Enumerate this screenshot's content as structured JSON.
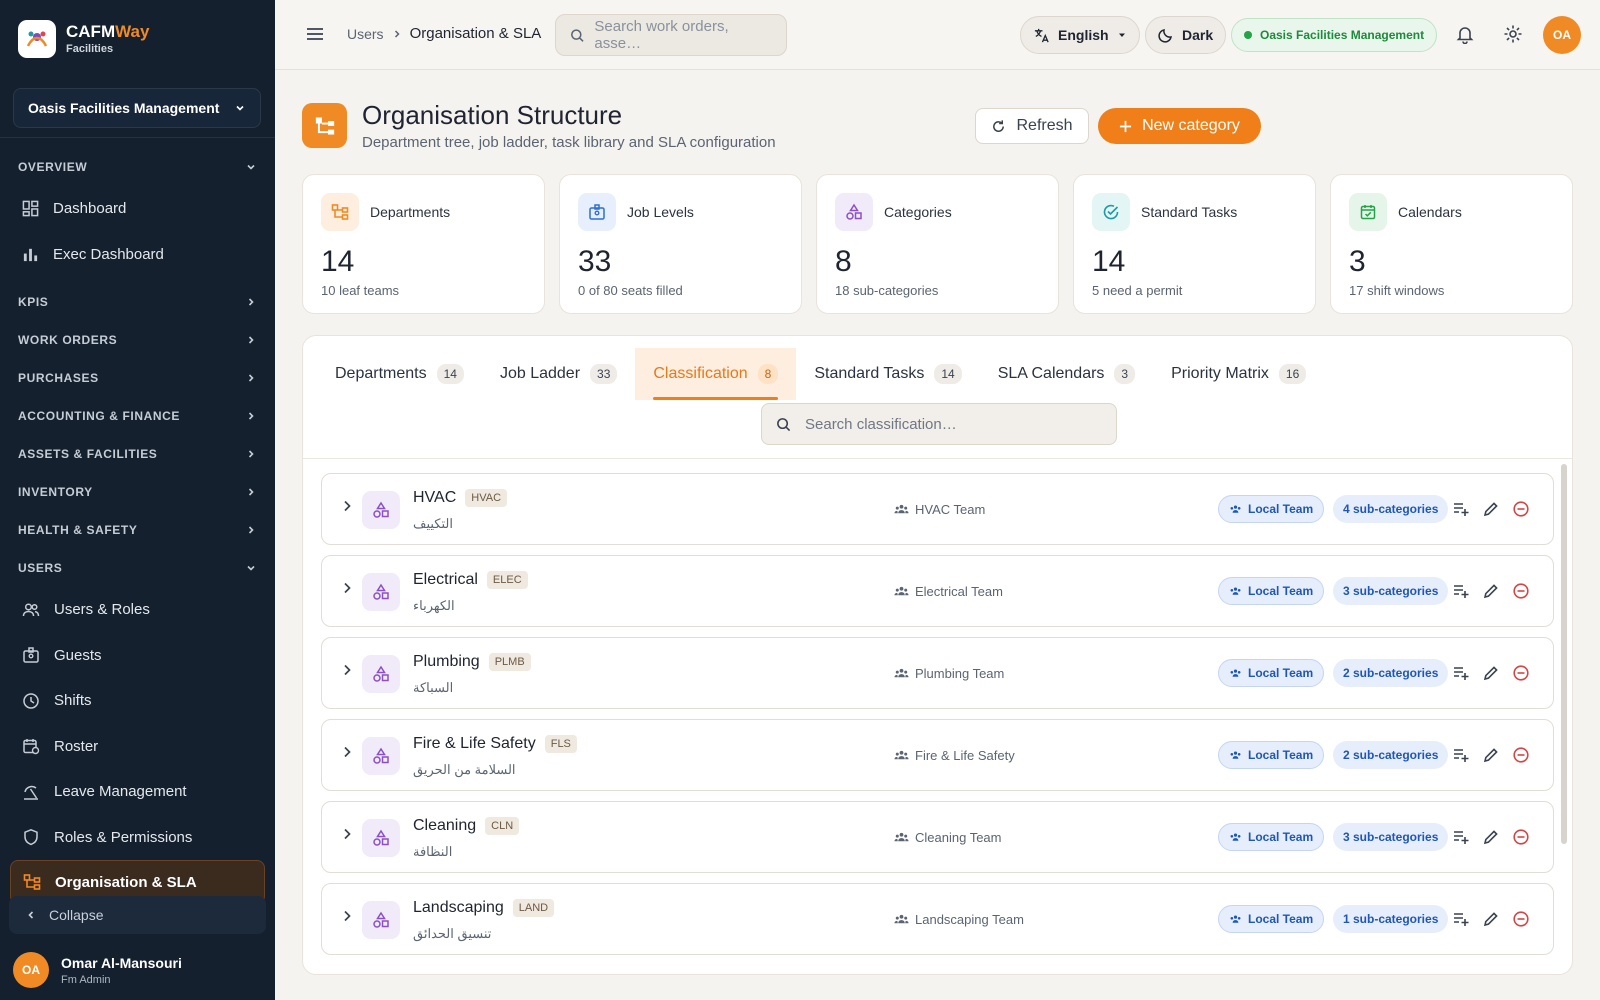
{
  "brand": {
    "name_a": "CAFM",
    "name_b": "Way",
    "sub": "Facilities"
  },
  "sidebar": {
    "org": "Oasis Facilities Management",
    "sections": {
      "overview": "OVERVIEW",
      "kpis": "KPIS",
      "work_orders": "WORK ORDERS",
      "purchases": "PURCHASES",
      "accounting": "ACCOUNTING & FINANCE",
      "assets": "ASSETS & FACILITIES",
      "inventory": "INVENTORY",
      "health": "HEALTH & SAFETY",
      "users": "USERS"
    },
    "items": {
      "dashboard": "Dashboard",
      "exec": "Exec Dashboard",
      "users_roles": "Users & Roles",
      "guests": "Guests",
      "shifts": "Shifts",
      "roster": "Roster",
      "leave": "Leave Management",
      "roles_perms": "Roles & Permissions",
      "org_sla": "Organisation & SLA"
    },
    "collapse": "Collapse",
    "user": {
      "initials": "OA",
      "name": "Omar Al-Mansouri",
      "role": "Fm Admin"
    }
  },
  "topbar": {
    "crumb_parent": "Users",
    "crumb_current": "Organisation & SLA",
    "search_placeholder": "Search work orders, asse…",
    "language": "English",
    "theme": "Dark",
    "org": "Oasis Facilities Management",
    "avatar": "OA"
  },
  "page": {
    "title": "Organisation Structure",
    "subtitle": "Department tree, job ladder, task library and SLA configuration",
    "refresh": "Refresh",
    "new_category": "New category"
  },
  "stats": [
    {
      "label": "Departments",
      "value": "14",
      "note": "10 leaf teams",
      "color": "#f08a24",
      "bg": "#fdeee0"
    },
    {
      "label": "Job Levels",
      "value": "33",
      "note": "0 of 80 seats filled",
      "color": "#2f6fd6",
      "bg": "#e7effc"
    },
    {
      "label": "Categories",
      "value": "8",
      "note": "18 sub-categories",
      "color": "#8a4fc9",
      "bg": "#f1eaf8"
    },
    {
      "label": "Standard Tasks",
      "value": "14",
      "note": "5 need a permit",
      "color": "#1f9aa6",
      "bg": "#e4f5f6"
    },
    {
      "label": "Calendars",
      "value": "3",
      "note": "17 shift windows",
      "color": "#22a447",
      "bg": "#e6f5ea"
    }
  ],
  "tabs": [
    {
      "label": "Departments",
      "count": "14"
    },
    {
      "label": "Job Ladder",
      "count": "33"
    },
    {
      "label": "Classification",
      "count": "8"
    },
    {
      "label": "Standard Tasks",
      "count": "14"
    },
    {
      "label": "SLA Calendars",
      "count": "3"
    },
    {
      "label": "Priority Matrix",
      "count": "16"
    }
  ],
  "panel_search_placeholder": "Search classification…",
  "categories": [
    {
      "name": "HVAC",
      "code": "HVAC",
      "arabic": "التكييف",
      "team": "HVAC Team",
      "scope": "Local Team",
      "subs": "4 sub-categories"
    },
    {
      "name": "Electrical",
      "code": "ELEC",
      "arabic": "الكهرباء",
      "team": "Electrical Team",
      "scope": "Local Team",
      "subs": "3 sub-categories"
    },
    {
      "name": "Plumbing",
      "code": "PLMB",
      "arabic": "السباكة",
      "team": "Plumbing Team",
      "scope": "Local Team",
      "subs": "2 sub-categories"
    },
    {
      "name": "Fire & Life Safety",
      "code": "FLS",
      "arabic": "السلامة من الحريق",
      "team": "Fire & Life Safety",
      "scope": "Local Team",
      "subs": "2 sub-categories"
    },
    {
      "name": "Cleaning",
      "code": "CLN",
      "arabic": "النظافة",
      "team": "Cleaning Team",
      "scope": "Local Team",
      "subs": "3 sub-categories"
    },
    {
      "name": "Landscaping",
      "code": "LAND",
      "arabic": "تنسيق الحدائق",
      "team": "Landscaping Team",
      "scope": "Local Team",
      "subs": "1 sub-categories"
    }
  ],
  "colors": {
    "accent": "#f07f1a",
    "sidebar": "#14202e",
    "success": "#22a447",
    "info": "#1f56b8",
    "danger": "#d64545"
  }
}
